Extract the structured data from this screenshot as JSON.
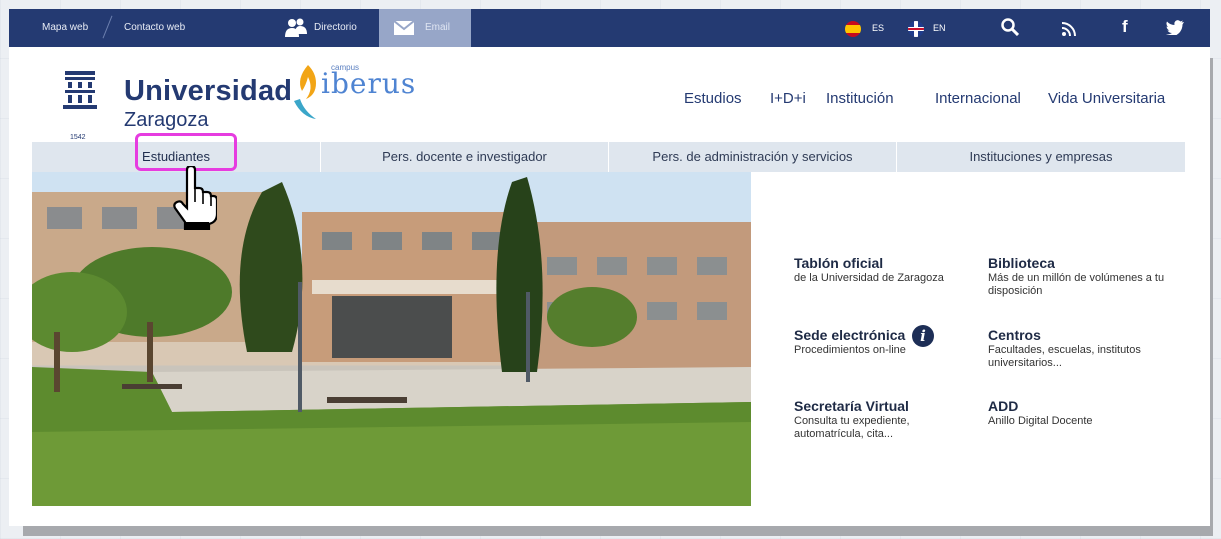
{
  "topbar": {
    "links": [
      "Mapa web",
      "Contacto web"
    ],
    "directory_label": "Directorio",
    "email_label": "Email",
    "lang_es": "ES",
    "lang_en": "EN",
    "icons": [
      "search-icon",
      "rss-icon",
      "facebook-icon",
      "twitter-icon"
    ]
  },
  "header": {
    "logo_line1": "Universidad",
    "logo_line2": "Zaragoza",
    "emblem_year": "1542",
    "campus_small": "campus",
    "campus_big": "iberus",
    "nav": [
      "Estudios",
      "I+D+i",
      "Institución",
      "Internacional",
      "Vida Universitaria"
    ]
  },
  "subnav": {
    "items": [
      "Estudiantes",
      "Pers. docente e investigador",
      "Pers. de administración y servicios",
      "Instituciones y empresas"
    ]
  },
  "quick_links": [
    {
      "title": "Tablón oficial",
      "desc": "de la Universidad de Zaragoza"
    },
    {
      "title": "Biblioteca",
      "desc": "Más de un millón de volúmenes a tu disposición"
    },
    {
      "title": "Sede electrónica",
      "desc": "Procedimientos on-line"
    },
    {
      "title": "Centros",
      "desc": "Facultades, escuelas, institutos universitarios..."
    },
    {
      "title": "Secretaría Virtual",
      "desc": "Consulta tu expediente, automatrícula, cita..."
    },
    {
      "title": "ADD",
      "desc": "Anillo Digital Docente"
    }
  ],
  "colors": {
    "brand_dark": "#243a72",
    "highlight": "#e63ce0",
    "subnav_bg": "#dfe6ee"
  }
}
